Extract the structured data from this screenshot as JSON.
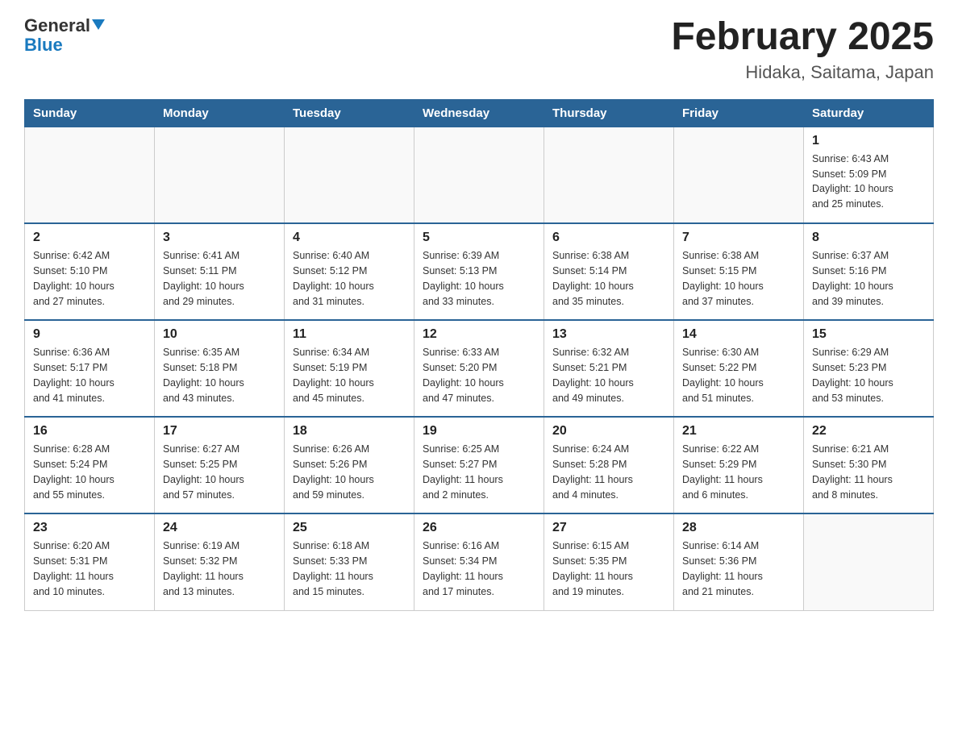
{
  "header": {
    "logo_general": "General",
    "logo_blue": "Blue",
    "month_title": "February 2025",
    "location": "Hidaka, Saitama, Japan"
  },
  "weekdays": [
    "Sunday",
    "Monday",
    "Tuesday",
    "Wednesday",
    "Thursday",
    "Friday",
    "Saturday"
  ],
  "weeks": [
    [
      {
        "day": "",
        "info": ""
      },
      {
        "day": "",
        "info": ""
      },
      {
        "day": "",
        "info": ""
      },
      {
        "day": "",
        "info": ""
      },
      {
        "day": "",
        "info": ""
      },
      {
        "day": "",
        "info": ""
      },
      {
        "day": "1",
        "info": "Sunrise: 6:43 AM\nSunset: 5:09 PM\nDaylight: 10 hours\nand 25 minutes."
      }
    ],
    [
      {
        "day": "2",
        "info": "Sunrise: 6:42 AM\nSunset: 5:10 PM\nDaylight: 10 hours\nand 27 minutes."
      },
      {
        "day": "3",
        "info": "Sunrise: 6:41 AM\nSunset: 5:11 PM\nDaylight: 10 hours\nand 29 minutes."
      },
      {
        "day": "4",
        "info": "Sunrise: 6:40 AM\nSunset: 5:12 PM\nDaylight: 10 hours\nand 31 minutes."
      },
      {
        "day": "5",
        "info": "Sunrise: 6:39 AM\nSunset: 5:13 PM\nDaylight: 10 hours\nand 33 minutes."
      },
      {
        "day": "6",
        "info": "Sunrise: 6:38 AM\nSunset: 5:14 PM\nDaylight: 10 hours\nand 35 minutes."
      },
      {
        "day": "7",
        "info": "Sunrise: 6:38 AM\nSunset: 5:15 PM\nDaylight: 10 hours\nand 37 minutes."
      },
      {
        "day": "8",
        "info": "Sunrise: 6:37 AM\nSunset: 5:16 PM\nDaylight: 10 hours\nand 39 minutes."
      }
    ],
    [
      {
        "day": "9",
        "info": "Sunrise: 6:36 AM\nSunset: 5:17 PM\nDaylight: 10 hours\nand 41 minutes."
      },
      {
        "day": "10",
        "info": "Sunrise: 6:35 AM\nSunset: 5:18 PM\nDaylight: 10 hours\nand 43 minutes."
      },
      {
        "day": "11",
        "info": "Sunrise: 6:34 AM\nSunset: 5:19 PM\nDaylight: 10 hours\nand 45 minutes."
      },
      {
        "day": "12",
        "info": "Sunrise: 6:33 AM\nSunset: 5:20 PM\nDaylight: 10 hours\nand 47 minutes."
      },
      {
        "day": "13",
        "info": "Sunrise: 6:32 AM\nSunset: 5:21 PM\nDaylight: 10 hours\nand 49 minutes."
      },
      {
        "day": "14",
        "info": "Sunrise: 6:30 AM\nSunset: 5:22 PM\nDaylight: 10 hours\nand 51 minutes."
      },
      {
        "day": "15",
        "info": "Sunrise: 6:29 AM\nSunset: 5:23 PM\nDaylight: 10 hours\nand 53 minutes."
      }
    ],
    [
      {
        "day": "16",
        "info": "Sunrise: 6:28 AM\nSunset: 5:24 PM\nDaylight: 10 hours\nand 55 minutes."
      },
      {
        "day": "17",
        "info": "Sunrise: 6:27 AM\nSunset: 5:25 PM\nDaylight: 10 hours\nand 57 minutes."
      },
      {
        "day": "18",
        "info": "Sunrise: 6:26 AM\nSunset: 5:26 PM\nDaylight: 10 hours\nand 59 minutes."
      },
      {
        "day": "19",
        "info": "Sunrise: 6:25 AM\nSunset: 5:27 PM\nDaylight: 11 hours\nand 2 minutes."
      },
      {
        "day": "20",
        "info": "Sunrise: 6:24 AM\nSunset: 5:28 PM\nDaylight: 11 hours\nand 4 minutes."
      },
      {
        "day": "21",
        "info": "Sunrise: 6:22 AM\nSunset: 5:29 PM\nDaylight: 11 hours\nand 6 minutes."
      },
      {
        "day": "22",
        "info": "Sunrise: 6:21 AM\nSunset: 5:30 PM\nDaylight: 11 hours\nand 8 minutes."
      }
    ],
    [
      {
        "day": "23",
        "info": "Sunrise: 6:20 AM\nSunset: 5:31 PM\nDaylight: 11 hours\nand 10 minutes."
      },
      {
        "day": "24",
        "info": "Sunrise: 6:19 AM\nSunset: 5:32 PM\nDaylight: 11 hours\nand 13 minutes."
      },
      {
        "day": "25",
        "info": "Sunrise: 6:18 AM\nSunset: 5:33 PM\nDaylight: 11 hours\nand 15 minutes."
      },
      {
        "day": "26",
        "info": "Sunrise: 6:16 AM\nSunset: 5:34 PM\nDaylight: 11 hours\nand 17 minutes."
      },
      {
        "day": "27",
        "info": "Sunrise: 6:15 AM\nSunset: 5:35 PM\nDaylight: 11 hours\nand 19 minutes."
      },
      {
        "day": "28",
        "info": "Sunrise: 6:14 AM\nSunset: 5:36 PM\nDaylight: 11 hours\nand 21 minutes."
      },
      {
        "day": "",
        "info": ""
      }
    ]
  ]
}
